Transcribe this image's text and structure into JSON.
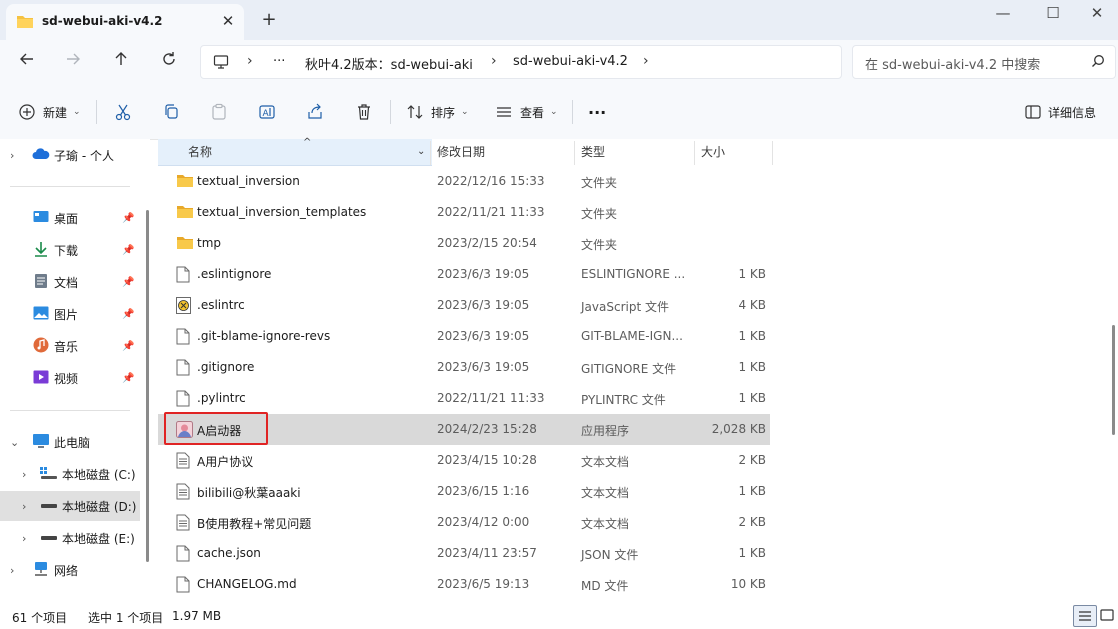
{
  "tab": {
    "title": "sd-webui-aki-v4.2",
    "close": "✕",
    "new": "+"
  },
  "window": {
    "minimize": "—",
    "maximize": "☐",
    "close": "✕"
  },
  "address": {
    "overflow": "···",
    "crumbs": [
      "秋叶4.2版本：sd-webui-aki",
      "sd-webui-aki-v4.2"
    ],
    "search_placeholder": "在 sd-webui-aki-v4.2 中搜索"
  },
  "toolbar": {
    "new_label": "新建",
    "sort_label": "排序",
    "view_label": "查看",
    "more_label": "···",
    "details_label": "详细信息"
  },
  "nav": {
    "cloud": "子瑜 - 个人",
    "quick": [
      "桌面",
      "下载",
      "文档",
      "图片",
      "音乐",
      "视频"
    ],
    "pc": "此电脑",
    "drives": [
      "本地磁盘 (C:)",
      "本地磁盘 (D:)",
      "本地磁盘 (E:)"
    ],
    "network": "网络"
  },
  "columns": {
    "name": "名称",
    "date": "修改日期",
    "type": "类型",
    "size": "大小"
  },
  "files": [
    {
      "name": "textual_inversion",
      "date": "2022/12/16 15:33",
      "type": "文件夹",
      "size": "",
      "icon": "folder"
    },
    {
      "name": "textual_inversion_templates",
      "date": "2022/11/21 11:33",
      "type": "文件夹",
      "size": "",
      "icon": "folder"
    },
    {
      "name": "tmp",
      "date": "2023/2/15 20:54",
      "type": "文件夹",
      "size": "",
      "icon": "folder"
    },
    {
      "name": ".eslintignore",
      "date": "2023/6/3 19:05",
      "type": "ESLINTIGNORE ...",
      "size": "1 KB",
      "icon": "file"
    },
    {
      "name": ".eslintrc",
      "date": "2023/6/3 19:05",
      "type": "JavaScript 文件",
      "size": "4 KB",
      "icon": "js"
    },
    {
      "name": ".git-blame-ignore-revs",
      "date": "2023/6/3 19:05",
      "type": "GIT-BLAME-IGN...",
      "size": "1 KB",
      "icon": "file"
    },
    {
      "name": ".gitignore",
      "date": "2023/6/3 19:05",
      "type": "GITIGNORE 文件",
      "size": "1 KB",
      "icon": "file"
    },
    {
      "name": ".pylintrc",
      "date": "2022/11/21 11:33",
      "type": "PYLINTRC 文件",
      "size": "1 KB",
      "icon": "file"
    },
    {
      "name": "A启动器",
      "date": "2024/2/23 15:28",
      "type": "应用程序",
      "size": "2,028 KB",
      "icon": "app"
    },
    {
      "name": "A用户协议",
      "date": "2023/4/15 10:28",
      "type": "文本文档",
      "size": "2 KB",
      "icon": "text"
    },
    {
      "name": "bilibili@秋葉aaaki",
      "date": "2023/6/15 1:16",
      "type": "文本文档",
      "size": "1 KB",
      "icon": "text"
    },
    {
      "name": "B使用教程+常见问题",
      "date": "2023/4/12 0:00",
      "type": "文本文档",
      "size": "2 KB",
      "icon": "text"
    },
    {
      "name": "cache.json",
      "date": "2023/4/11 23:57",
      "type": "JSON 文件",
      "size": "1 KB",
      "icon": "file"
    },
    {
      "name": "CHANGELOG.md",
      "date": "2023/6/5 19:13",
      "type": "MD 文件",
      "size": "10 KB",
      "icon": "file"
    }
  ],
  "status": {
    "count": "61 个项目",
    "selected": "选中 1 个项目",
    "size": "1.97 MB"
  },
  "colors": {
    "accent": "#0067c0",
    "folder": "#f5c242",
    "highlight": "#e02424"
  }
}
